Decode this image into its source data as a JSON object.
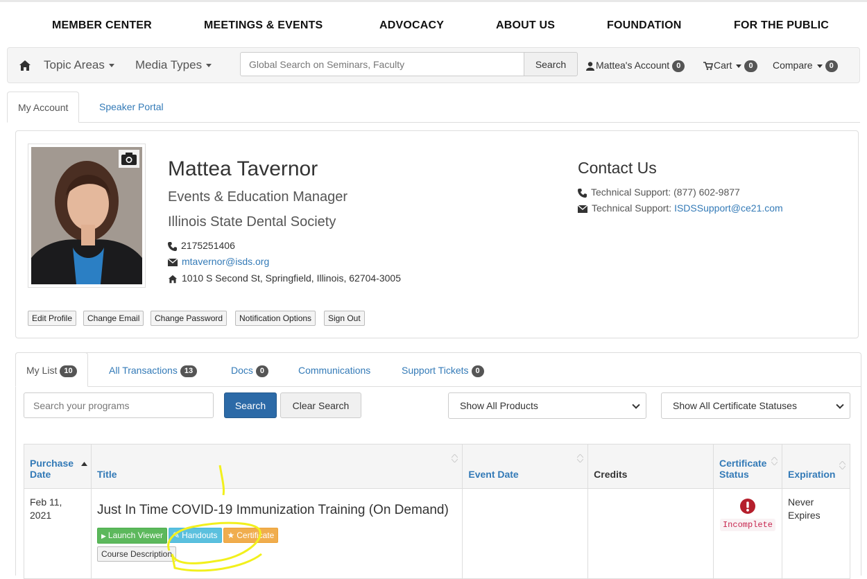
{
  "top_nav": [
    "MEMBER CENTER",
    "MEETINGS & EVENTS",
    "ADVOCACY",
    "ABOUT US",
    "FOUNDATION",
    "FOR THE PUBLIC"
  ],
  "toolbar": {
    "topic_areas": "Topic Areas",
    "media_types": "Media Types",
    "search_placeholder": "Global Search on Seminars, Faculty",
    "search_button": "Search",
    "account": "Mattea's Account",
    "account_count": "0",
    "cart": "Cart",
    "cart_count": "0",
    "compare": "Compare",
    "compare_count": "0"
  },
  "account_tabs": [
    "My Account",
    "Speaker Portal"
  ],
  "profile": {
    "name": "Mattea Tavernor",
    "title": "Events & Education Manager",
    "org": "Illinois State Dental Society",
    "phone": "2175251406",
    "email": "mtavernor@isds.org",
    "address": "1010 S Second St, Springfield, Illinois, 62704-3005",
    "buttons": [
      "Edit Profile",
      "Change Email",
      "Change Password",
      "Notification Options",
      "Sign Out"
    ]
  },
  "contact": {
    "heading": "Contact Us",
    "phone_line": "Technical Support: (877) 602-9877",
    "email_label": "Technical Support: ",
    "email": "ISDSSupport@ce21.com"
  },
  "list_tabs": [
    {
      "label": "My List",
      "count": "10"
    },
    {
      "label": "All Transactions",
      "count": "13"
    },
    {
      "label": "Docs",
      "count": "0"
    },
    {
      "label": "Communications",
      "count": ""
    },
    {
      "label": "Support Tickets",
      "count": "0"
    }
  ],
  "filters": {
    "search_placeholder": "Search your programs",
    "search_button": "Search",
    "clear_button": "Clear Search",
    "products_select": "Show All Products",
    "cert_select": "Show All Certificate Statuses"
  },
  "table": {
    "headers": [
      "Purchase Date",
      "Title",
      "Event Date",
      "Credits",
      "Certificate Status",
      "Expiration"
    ],
    "rows": [
      {
        "date": "Feb 11, 2021",
        "title": "Just In Time COVID-19 Immunization Training (On Demand)",
        "buttons": {
          "launch": "Launch Viewer",
          "handouts": "Handouts",
          "certificate": "Certificate",
          "description": "Course Description"
        },
        "event_date": "",
        "credits": "",
        "status": "Incomplete",
        "expiration": "Never Expires"
      }
    ]
  },
  "colors": {
    "link": "#337ab7",
    "primary": "#2c6aa7",
    "success": "#5cb85c",
    "info": "#5bc0de",
    "warning": "#f0ad4e",
    "danger": "#b51f2c",
    "highlight": "#f2f01d"
  }
}
